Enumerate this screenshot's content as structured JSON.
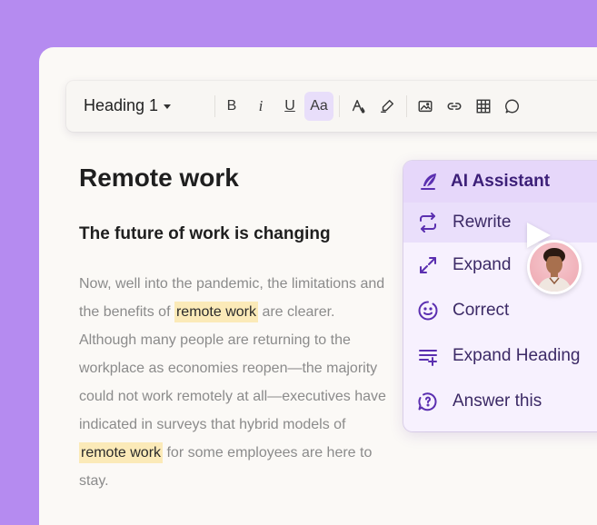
{
  "toolbar": {
    "heading_style": "Heading 1",
    "bold": "B",
    "italic": "i",
    "underline": "U",
    "case": "Aa"
  },
  "document": {
    "title": "Remote work",
    "subtitle": "The future of work is changing",
    "body_1": "Now, well into the pandemic, the limitations and the benefits of ",
    "highlight_1": "remote work",
    "body_2": " are clearer. Although many people are returning to the workplace as economies reopen—the majority could not work remotely at all—executives have indicated in surveys that hybrid models of ",
    "highlight_2": "remote work",
    "body_3": " for some employees are here to stay."
  },
  "ai_assistant": {
    "title": "AI Assistant",
    "items": [
      {
        "label": "Rewrite",
        "icon": "rewrite-icon"
      },
      {
        "label": "Expand",
        "icon": "expand-icon"
      },
      {
        "label": "Correct",
        "icon": "correct-icon"
      },
      {
        "label": "Expand Heading",
        "icon": "expand-heading-icon"
      },
      {
        "label": "Answer this",
        "icon": "answer-icon"
      }
    ]
  },
  "colors": {
    "background": "#b58bf0",
    "accent": "#5b2fb0",
    "highlight": "#fbeab8",
    "panel_header": "#e6d7fa"
  }
}
